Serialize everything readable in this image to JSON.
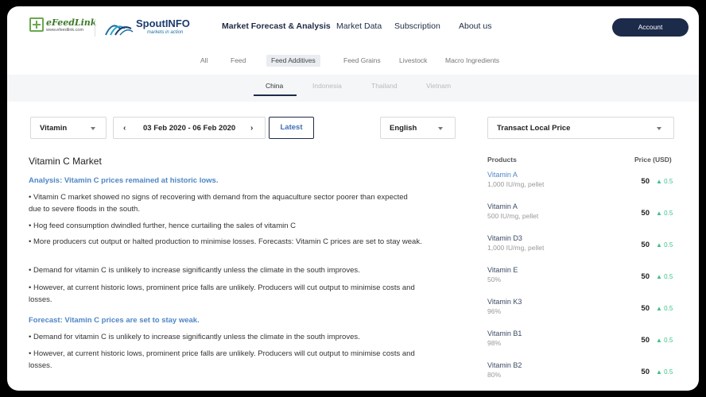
{
  "header": {
    "logo1": {
      "name": "eFeedLink",
      "url": "www.efeedlink.com"
    },
    "logo2": {
      "name": "SpoutINFO",
      "tagline": "markets in action"
    },
    "nav": [
      {
        "label": "Market Forecast & Analysis",
        "active": true
      },
      {
        "label": "Market Data",
        "active": false
      },
      {
        "label": "Subscription",
        "active": false
      },
      {
        "label": "About us",
        "active": false
      }
    ],
    "account_label": "Account"
  },
  "categories": [
    {
      "label": "All",
      "active": false
    },
    {
      "label": "Feed",
      "active": false
    },
    {
      "label": "Feed Additives",
      "active": true
    },
    {
      "label": "Feed Grains",
      "active": false
    },
    {
      "label": "Livestock",
      "active": false
    },
    {
      "label": "Macro Ingredients",
      "active": false
    }
  ],
  "regions": [
    {
      "label": "China",
      "active": true
    },
    {
      "label": "Indonesia",
      "active": false
    },
    {
      "label": "Thailand",
      "active": false
    },
    {
      "label": "Vietnam",
      "active": false
    }
  ],
  "controls": {
    "product_select": "Vitamin",
    "date_range": "03 Feb 2020 - 06 Feb 2020",
    "latest_label": "Latest",
    "language_select": "English",
    "price_type_select": "Transact Local Price"
  },
  "article": {
    "title": "Vitamin C Market",
    "analysis_heading": "Analysis: Vitamin C prices remained at historic lows.",
    "analysis_points": [
      "• Vitamin C market showed no signs of recovering with demand from the aquaculture sector poorer than expected due to severe floods in the south.",
      "• Hog feed consumption dwindled further, hence curtailing the sales of vitamin C",
      "• More producers cut output or halted production to minimise losses. Forecasts: Vitamin C prices are set to stay weak.",
      "• Demand for vitamin C is unlikely to increase significantly unless the climate in the south improves.",
      "• However, at current historic lows, prominent price falls are unlikely. Producers will cut output to minimise costs and losses."
    ],
    "forecast_heading": "Forecast: Vitamin C prices are set to stay weak.",
    "forecast_points": [
      "• Demand for vitamin C is unlikely to increase significantly unless the climate in the south improves.",
      "• However, at current historic lows, prominent price falls are unlikely. Producers will cut output to minimise costs and losses."
    ]
  },
  "products": {
    "col_products": "Products",
    "col_price": "Price (USD)",
    "items": [
      {
        "name": "Vitamin A",
        "spec": "1,000 IU/mg, pellet",
        "price": "50",
        "change": "▲ 0.5",
        "highlight": true
      },
      {
        "name": "Vitamin A",
        "spec": "500 IU/mg, pellet",
        "price": "50",
        "change": "▲ 0.5",
        "highlight": false
      },
      {
        "name": "Vitamin D3",
        "spec": "1,000 IU/mg, pellet",
        "price": "50",
        "change": "▲ 0.5",
        "highlight": false
      },
      {
        "name": "Vitamin E",
        "spec": "50%",
        "price": "50",
        "change": "▲ 0.5",
        "highlight": false
      },
      {
        "name": "Vitamin K3",
        "spec": "96%",
        "price": "50",
        "change": "▲ 0.5",
        "highlight": false
      },
      {
        "name": "Vitamin B1",
        "spec": "98%",
        "price": "50",
        "change": "▲ 0.5",
        "highlight": false
      },
      {
        "name": "Vitamin B2",
        "spec": "80%",
        "price": "50",
        "change": "▲ 0.5",
        "highlight": false
      }
    ]
  },
  "colors": {
    "accent_blue": "#4f86c6",
    "navy": "#1c2b4a",
    "up_green": "#3cc08a"
  }
}
